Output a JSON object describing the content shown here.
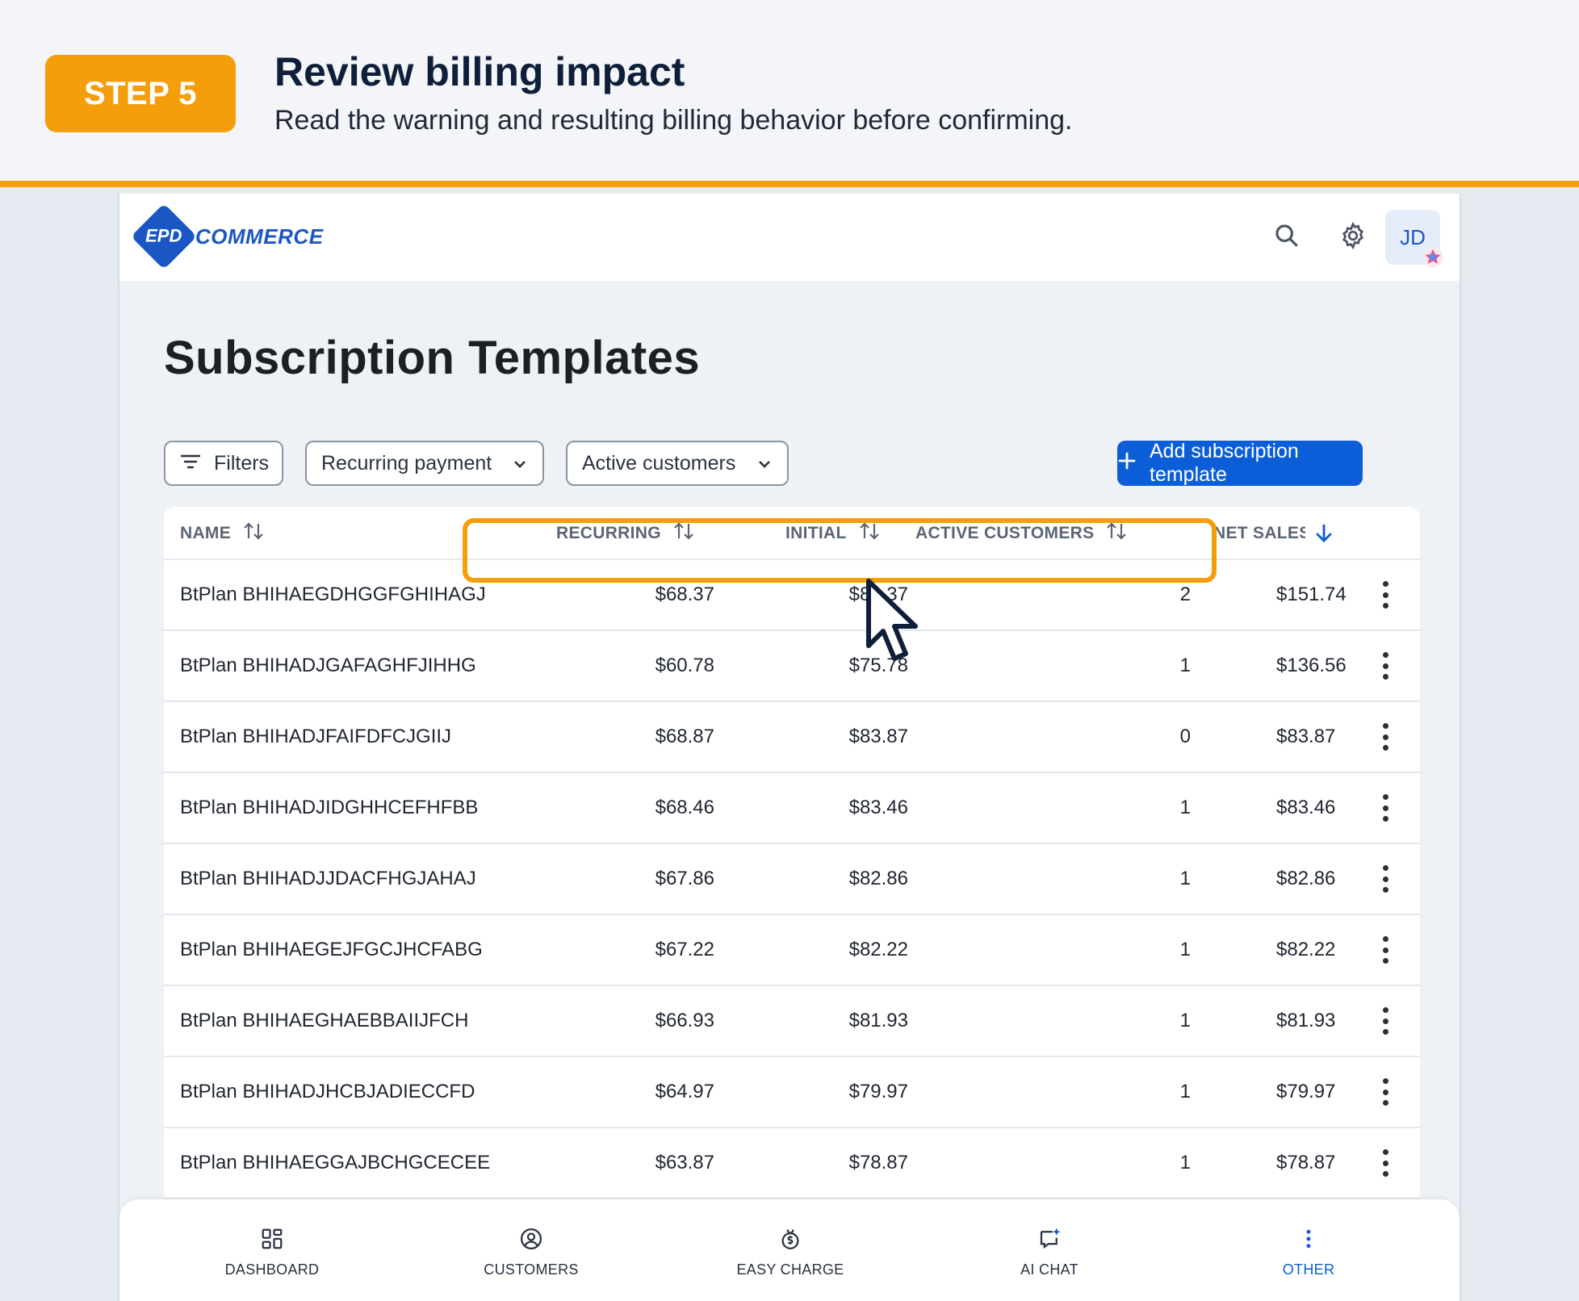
{
  "banner": {
    "step_label": "STEP 5",
    "title": "Review billing impact",
    "subtitle": "Read the warning and resulting billing behavior before confirming."
  },
  "app": {
    "logo_mark": "EPD",
    "logo_text": "COMMERCE",
    "avatar_initials": "JD",
    "page_title": "Subscription Templates",
    "toolbar": {
      "filters_label": "Filters",
      "recurring_select": "Recurring payment",
      "customers_select": "Active customers",
      "add_button": "Add subscription template"
    },
    "table": {
      "headers": {
        "name": "NAME",
        "recurring": "RECURRING",
        "initial": "INITIAL",
        "active_customers": "ACTIVE CUSTOMERS",
        "net_sales": "NET SALES"
      },
      "rows": [
        {
          "name": "BtPlan BHIHAEGDHGGFGHIHAGJ",
          "recurring": "$68.37",
          "initial": "$83.37",
          "active": "2",
          "net_sales": "$151.74"
        },
        {
          "name": "BtPlan BHIHADJGAFAGHFJIHHG",
          "recurring": "$60.78",
          "initial": "$75.78",
          "active": "1",
          "net_sales": "$136.56"
        },
        {
          "name": "BtPlan BHIHADJFAIFDFCJGIIJ",
          "recurring": "$68.87",
          "initial": "$83.87",
          "active": "0",
          "net_sales": "$83.87"
        },
        {
          "name": "BtPlan BHIHADJIDGHHCEFHFBB",
          "recurring": "$68.46",
          "initial": "$83.46",
          "active": "1",
          "net_sales": "$83.46"
        },
        {
          "name": "BtPlan BHIHADJJDACFHGJAHAJ",
          "recurring": "$67.86",
          "initial": "$82.86",
          "active": "1",
          "net_sales": "$82.86"
        },
        {
          "name": "BtPlan BHIHAEGEJFGCJHCFABG",
          "recurring": "$67.22",
          "initial": "$82.22",
          "active": "1",
          "net_sales": "$82.22"
        },
        {
          "name": "BtPlan BHIHAEGHAEBBAIIJFCH",
          "recurring": "$66.93",
          "initial": "$81.93",
          "active": "1",
          "net_sales": "$81.93"
        },
        {
          "name": "BtPlan BHIHADJHCBJADIECCFD",
          "recurring": "$64.97",
          "initial": "$79.97",
          "active": "1",
          "net_sales": "$79.97"
        },
        {
          "name": "BtPlan BHIHAEGGAJBCHGCECEE",
          "recurring": "$63.87",
          "initial": "$78.87",
          "active": "1",
          "net_sales": "$78.87"
        }
      ]
    },
    "bottom_nav": {
      "dashboard": "DASHBOARD",
      "customers": "CUSTOMERS",
      "easy_charge": "EASY CHARGE",
      "ai_chat": "AI CHAT",
      "other": "OTHER"
    }
  },
  "colors": {
    "accent_orange": "#f59e0b",
    "primary_blue": "#0b5ed7",
    "brand_blue": "#1a56c4"
  }
}
